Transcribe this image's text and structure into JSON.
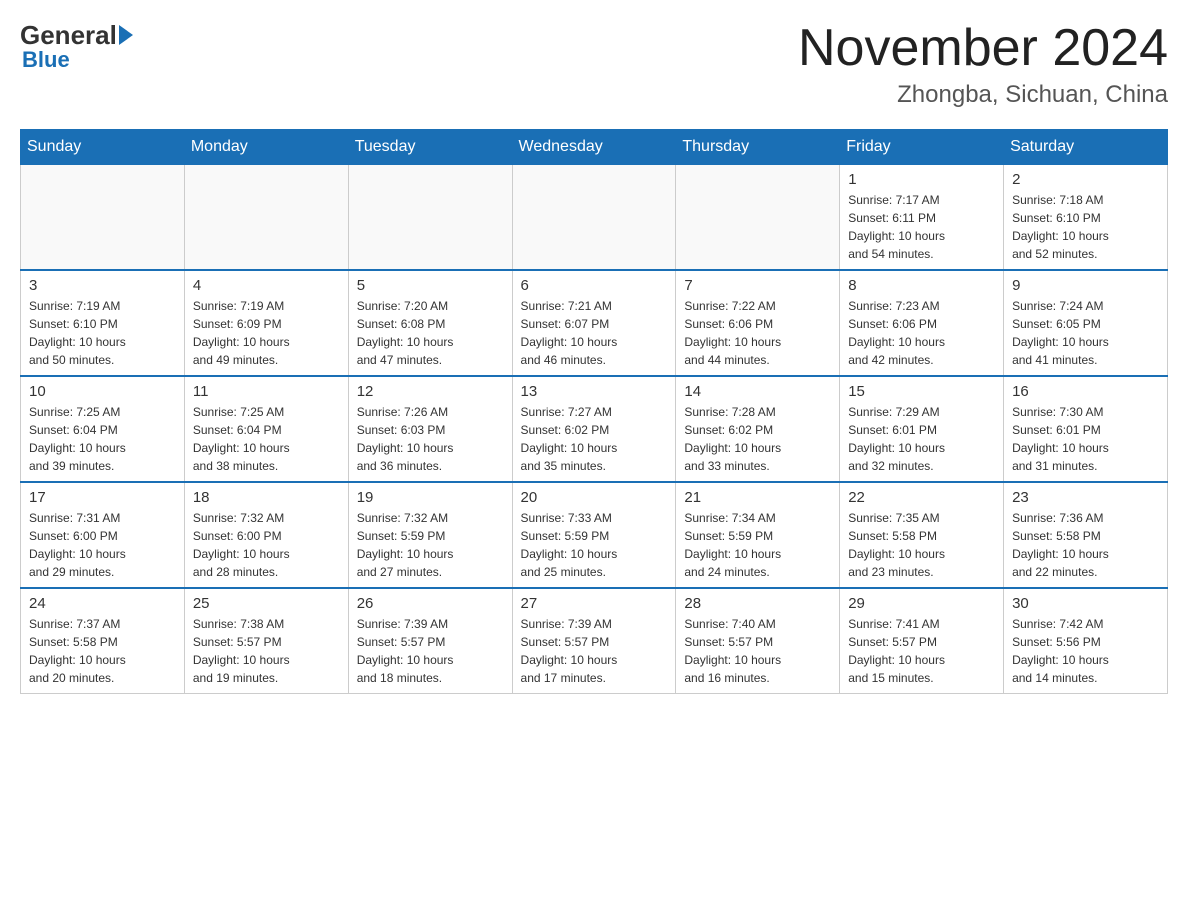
{
  "header": {
    "logo_general": "General",
    "logo_blue": "Blue",
    "title": "November 2024",
    "subtitle": "Zhongba, Sichuan, China"
  },
  "calendar": {
    "days_of_week": [
      "Sunday",
      "Monday",
      "Tuesday",
      "Wednesday",
      "Thursday",
      "Friday",
      "Saturday"
    ],
    "weeks": [
      [
        {
          "day": "",
          "info": ""
        },
        {
          "day": "",
          "info": ""
        },
        {
          "day": "",
          "info": ""
        },
        {
          "day": "",
          "info": ""
        },
        {
          "day": "",
          "info": ""
        },
        {
          "day": "1",
          "info": "Sunrise: 7:17 AM\nSunset: 6:11 PM\nDaylight: 10 hours\nand 54 minutes."
        },
        {
          "day": "2",
          "info": "Sunrise: 7:18 AM\nSunset: 6:10 PM\nDaylight: 10 hours\nand 52 minutes."
        }
      ],
      [
        {
          "day": "3",
          "info": "Sunrise: 7:19 AM\nSunset: 6:10 PM\nDaylight: 10 hours\nand 50 minutes."
        },
        {
          "day": "4",
          "info": "Sunrise: 7:19 AM\nSunset: 6:09 PM\nDaylight: 10 hours\nand 49 minutes."
        },
        {
          "day": "5",
          "info": "Sunrise: 7:20 AM\nSunset: 6:08 PM\nDaylight: 10 hours\nand 47 minutes."
        },
        {
          "day": "6",
          "info": "Sunrise: 7:21 AM\nSunset: 6:07 PM\nDaylight: 10 hours\nand 46 minutes."
        },
        {
          "day": "7",
          "info": "Sunrise: 7:22 AM\nSunset: 6:06 PM\nDaylight: 10 hours\nand 44 minutes."
        },
        {
          "day": "8",
          "info": "Sunrise: 7:23 AM\nSunset: 6:06 PM\nDaylight: 10 hours\nand 42 minutes."
        },
        {
          "day": "9",
          "info": "Sunrise: 7:24 AM\nSunset: 6:05 PM\nDaylight: 10 hours\nand 41 minutes."
        }
      ],
      [
        {
          "day": "10",
          "info": "Sunrise: 7:25 AM\nSunset: 6:04 PM\nDaylight: 10 hours\nand 39 minutes."
        },
        {
          "day": "11",
          "info": "Sunrise: 7:25 AM\nSunset: 6:04 PM\nDaylight: 10 hours\nand 38 minutes."
        },
        {
          "day": "12",
          "info": "Sunrise: 7:26 AM\nSunset: 6:03 PM\nDaylight: 10 hours\nand 36 minutes."
        },
        {
          "day": "13",
          "info": "Sunrise: 7:27 AM\nSunset: 6:02 PM\nDaylight: 10 hours\nand 35 minutes."
        },
        {
          "day": "14",
          "info": "Sunrise: 7:28 AM\nSunset: 6:02 PM\nDaylight: 10 hours\nand 33 minutes."
        },
        {
          "day": "15",
          "info": "Sunrise: 7:29 AM\nSunset: 6:01 PM\nDaylight: 10 hours\nand 32 minutes."
        },
        {
          "day": "16",
          "info": "Sunrise: 7:30 AM\nSunset: 6:01 PM\nDaylight: 10 hours\nand 31 minutes."
        }
      ],
      [
        {
          "day": "17",
          "info": "Sunrise: 7:31 AM\nSunset: 6:00 PM\nDaylight: 10 hours\nand 29 minutes."
        },
        {
          "day": "18",
          "info": "Sunrise: 7:32 AM\nSunset: 6:00 PM\nDaylight: 10 hours\nand 28 minutes."
        },
        {
          "day": "19",
          "info": "Sunrise: 7:32 AM\nSunset: 5:59 PM\nDaylight: 10 hours\nand 27 minutes."
        },
        {
          "day": "20",
          "info": "Sunrise: 7:33 AM\nSunset: 5:59 PM\nDaylight: 10 hours\nand 25 minutes."
        },
        {
          "day": "21",
          "info": "Sunrise: 7:34 AM\nSunset: 5:59 PM\nDaylight: 10 hours\nand 24 minutes."
        },
        {
          "day": "22",
          "info": "Sunrise: 7:35 AM\nSunset: 5:58 PM\nDaylight: 10 hours\nand 23 minutes."
        },
        {
          "day": "23",
          "info": "Sunrise: 7:36 AM\nSunset: 5:58 PM\nDaylight: 10 hours\nand 22 minutes."
        }
      ],
      [
        {
          "day": "24",
          "info": "Sunrise: 7:37 AM\nSunset: 5:58 PM\nDaylight: 10 hours\nand 20 minutes."
        },
        {
          "day": "25",
          "info": "Sunrise: 7:38 AM\nSunset: 5:57 PM\nDaylight: 10 hours\nand 19 minutes."
        },
        {
          "day": "26",
          "info": "Sunrise: 7:39 AM\nSunset: 5:57 PM\nDaylight: 10 hours\nand 18 minutes."
        },
        {
          "day": "27",
          "info": "Sunrise: 7:39 AM\nSunset: 5:57 PM\nDaylight: 10 hours\nand 17 minutes."
        },
        {
          "day": "28",
          "info": "Sunrise: 7:40 AM\nSunset: 5:57 PM\nDaylight: 10 hours\nand 16 minutes."
        },
        {
          "day": "29",
          "info": "Sunrise: 7:41 AM\nSunset: 5:57 PM\nDaylight: 10 hours\nand 15 minutes."
        },
        {
          "day": "30",
          "info": "Sunrise: 7:42 AM\nSunset: 5:56 PM\nDaylight: 10 hours\nand 14 minutes."
        }
      ]
    ]
  }
}
